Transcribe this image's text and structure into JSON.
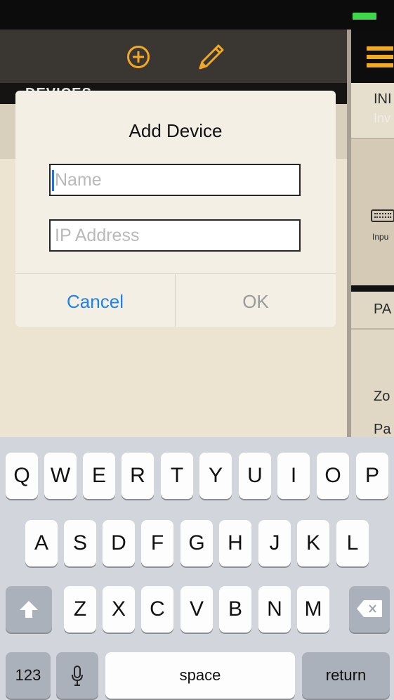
{
  "left_panel": {
    "header_title": "DEVICES"
  },
  "right_panel": {
    "section1_title": "INI",
    "section1_subtitle": "Inv",
    "input_label": "Inpu",
    "section2_title": "PA",
    "row1": "Zo",
    "row2": "Pa"
  },
  "dialog": {
    "title": "Add Device",
    "name_placeholder": "Name",
    "ip_placeholder": "IP Address",
    "cancel_label": "Cancel",
    "ok_label": "OK"
  },
  "keyboard": {
    "row1": [
      "Q",
      "W",
      "E",
      "R",
      "T",
      "Y",
      "U",
      "I",
      "O",
      "P"
    ],
    "row2": [
      "A",
      "S",
      "D",
      "F",
      "G",
      "H",
      "J",
      "K",
      "L"
    ],
    "row3": [
      "Z",
      "X",
      "C",
      "V",
      "B",
      "N",
      "M"
    ],
    "numbers_label": "123",
    "space_label": "space",
    "return_label": "return"
  },
  "colors": {
    "accent": "#f2a820",
    "link_blue": "#1e82e6",
    "battery_green": "#3fd84a"
  }
}
